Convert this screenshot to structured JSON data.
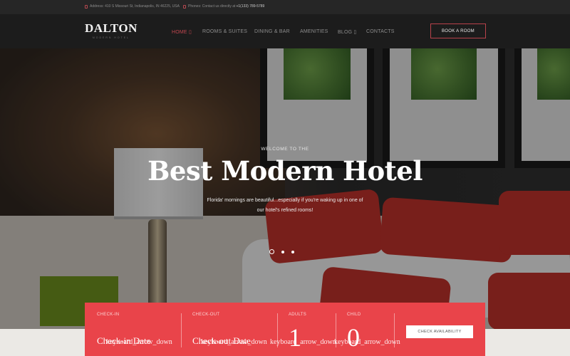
{
  "topbar": {
    "address_label": "Address:",
    "address_value": "410 S Missouri St, Indianapolis, IN 46225, USA",
    "phone_label": "Phones:",
    "phone_text": "Contact us directly at",
    "phone_value": "+1(133) 789-5789"
  },
  "header": {
    "logo_name": "DALTON",
    "logo_sub": "MODERN HOTEL",
    "nav": [
      {
        "label": "HOME ▯",
        "active": true
      },
      {
        "label": "ROOMS & SUITES",
        "active": false
      },
      {
        "label": "DINING & BAR",
        "active": false
      },
      {
        "label": "AMENITIES",
        "active": false
      },
      {
        "label": "BLOG ▯",
        "active": false
      },
      {
        "label": "CONTACTS",
        "active": false
      }
    ],
    "book_button": "BOOK A ROOM"
  },
  "hero": {
    "eyebrow": "WELCOME TO THE",
    "headline": "Best Modern Hotel",
    "description_line1": "Florida' mornings are beautiful...especially if you're waking up in one of",
    "description_line2": "our hotel's refined rooms!",
    "slides": {
      "count": 3,
      "active_index": 0
    }
  },
  "booking": {
    "checkin_label": "CHECK-IN",
    "checkin_value": "Check-in Date",
    "checkin_icon_text": "keyboard_arrow_down",
    "checkout_label": "CHECK-OUT",
    "checkout_value": "Check-out Date",
    "checkout_icon_text": "keyboard_arrow_down",
    "adults_label": "ADULTS",
    "adults_value": "1",
    "adults_icon_text": "keyboard_arrow_down",
    "child_label": "CHILD",
    "child_value": "0",
    "child_icon_text": "keyboard_arrow_down",
    "check_button": "CHECK AVAILABILITY"
  },
  "colors": {
    "accent": "#e9444a",
    "nav_active": "#c1464f",
    "header_bg": "#1c1c1c",
    "topbar_bg": "#262626"
  }
}
